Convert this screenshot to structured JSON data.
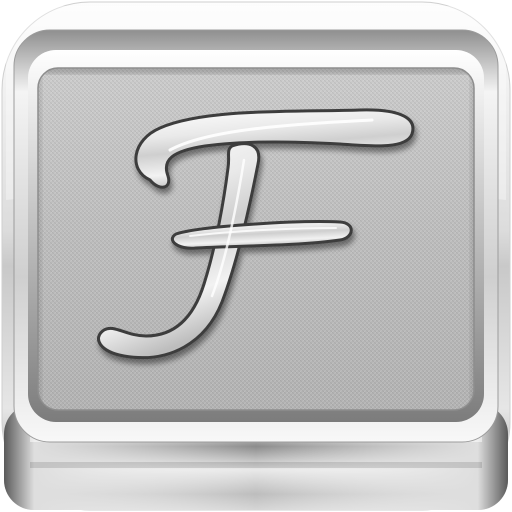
{
  "icon": {
    "glyph": "F",
    "glyph_name": "script-letter-f-icon",
    "style": "chrome-beveled-app-icon",
    "colors": {
      "chrome_light": "#fbfbfb",
      "chrome_mid": "#d2d2d2",
      "chrome_dark": "#6a6a6a",
      "panel_light": "#c9c9c9",
      "panel_dark": "#b4b4b4",
      "glyph_fill": "#e4e4e4",
      "glyph_outline": "#3c3c3c"
    }
  }
}
